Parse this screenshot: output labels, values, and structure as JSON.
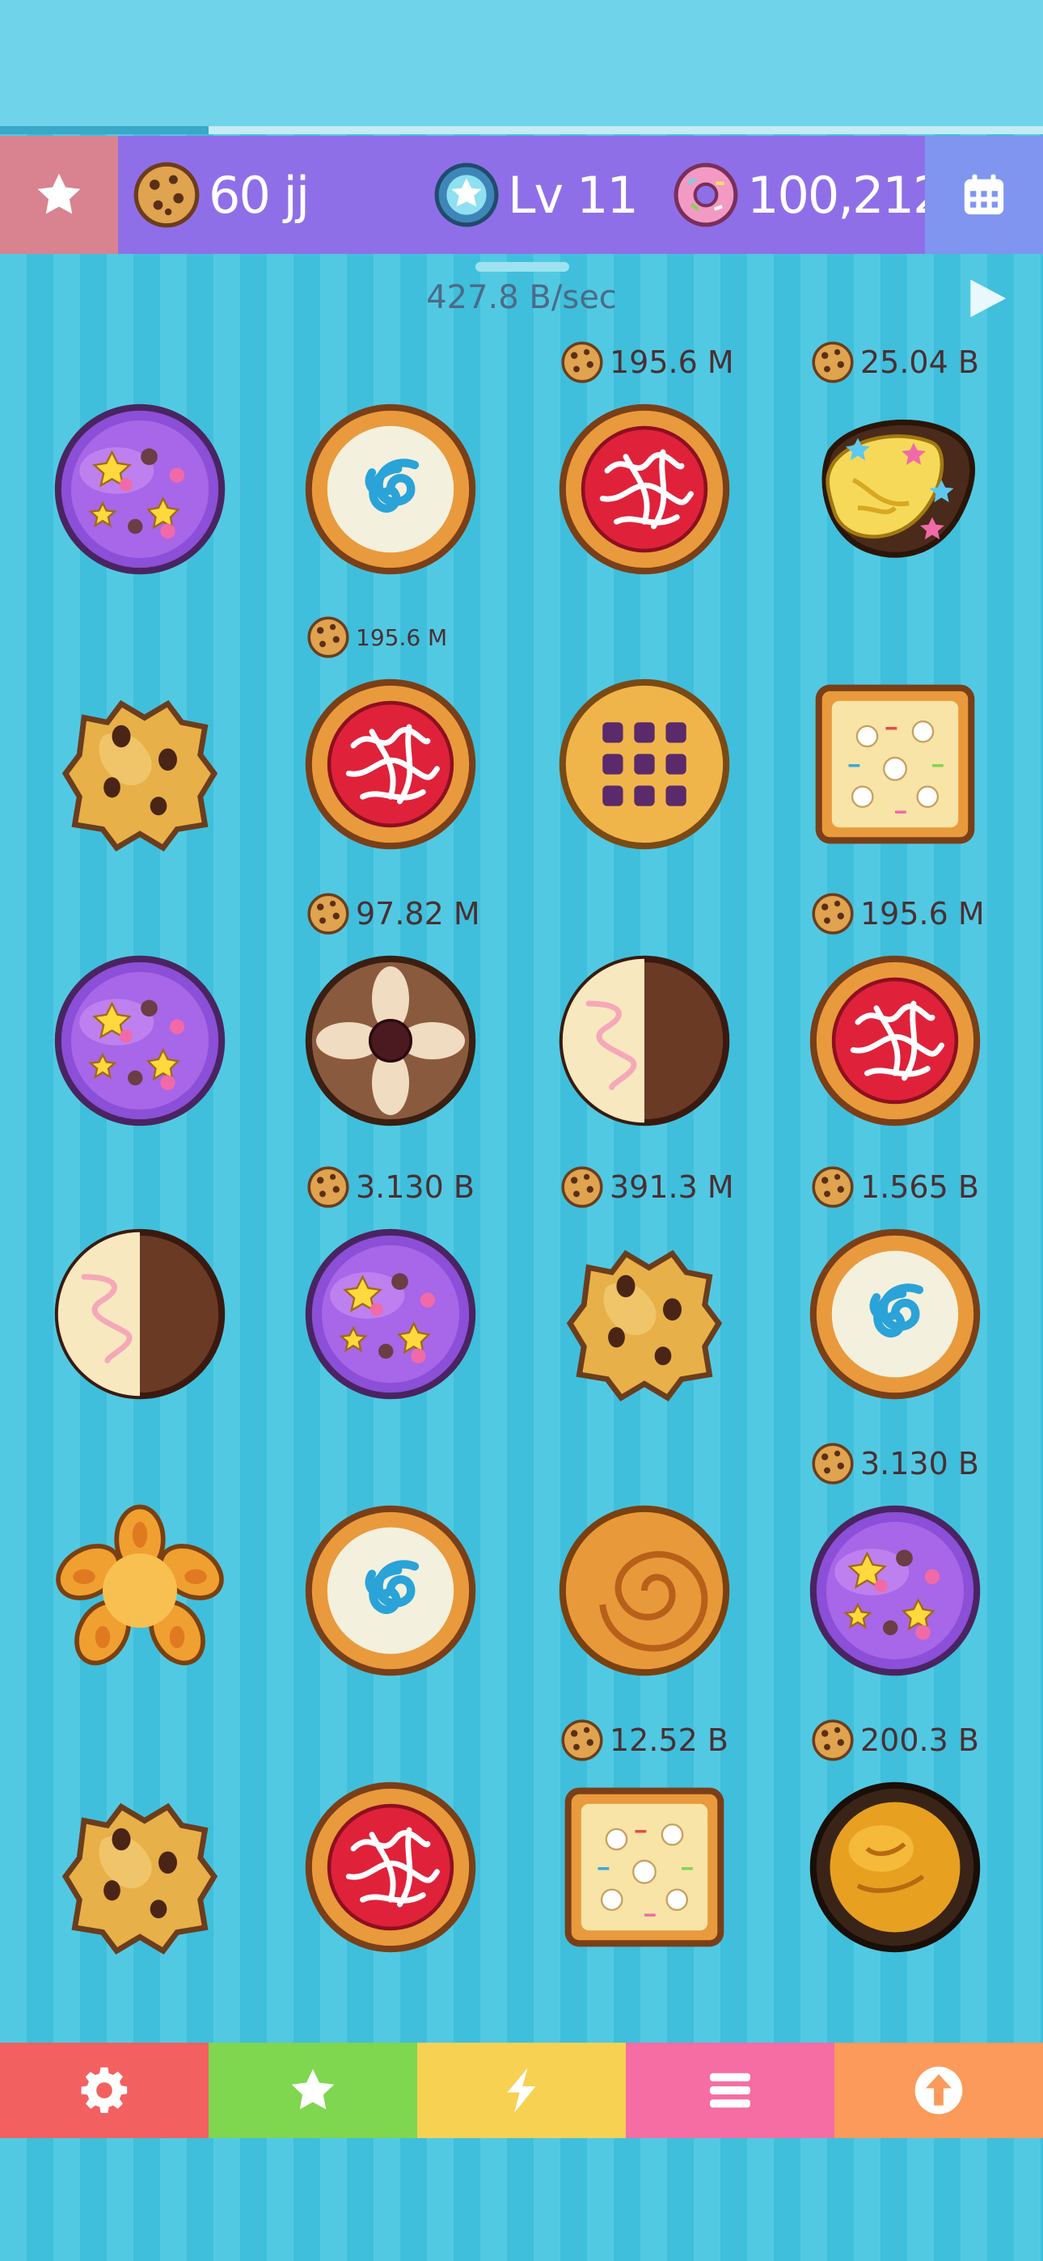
{
  "hud": {
    "cookies": "60 jj",
    "level": "Lv 11",
    "donuts": "100,212",
    "progress_fraction": 0.2
  },
  "rate": "427.8 B/sec",
  "icons": {
    "hud_left": "star-icon",
    "hud_right": "calendar-icon",
    "play": "play-icon",
    "tabs": [
      "gear-icon",
      "star-icon",
      "lightning-icon",
      "menu-icon",
      "upgrade-arrow-icon"
    ]
  },
  "colors": {
    "hud_bar": "#8f6fe8",
    "tab_settings": "#f36060",
    "tab_favorites": "#7fd64f",
    "tab_boost": "#f7d152",
    "tab_menu": "#f66da3",
    "tab_upgrade": "#fb9a5a"
  },
  "cookies": [
    {
      "row": 0,
      "col": 0,
      "type": "galaxy",
      "price": ""
    },
    {
      "row": 0,
      "col": 1,
      "type": "swirl-blue",
      "price": ""
    },
    {
      "row": 0,
      "col": 2,
      "type": "red-pizza",
      "price": "195.6 M"
    },
    {
      "row": 0,
      "col": 3,
      "type": "cream-star",
      "price": "25.04 B"
    },
    {
      "row": 1,
      "col": 0,
      "type": "chunky-chip",
      "price": ""
    },
    {
      "row": 1,
      "col": 1,
      "type": "red-pizza",
      "price": "195.6 M"
    },
    {
      "row": 1,
      "col": 2,
      "type": "waffle-berry",
      "price": ""
    },
    {
      "row": 1,
      "col": 3,
      "type": "square-sprinkle",
      "price": ""
    },
    {
      "row": 2,
      "col": 0,
      "type": "galaxy",
      "price": ""
    },
    {
      "row": 2,
      "col": 1,
      "type": "choc-flower",
      "price": "97.82 M"
    },
    {
      "row": 2,
      "col": 2,
      "type": "half-dipped",
      "price": ""
    },
    {
      "row": 2,
      "col": 3,
      "type": "red-pizza",
      "price": "195.6 M"
    },
    {
      "row": 3,
      "col": 0,
      "type": "half-dipped",
      "price": ""
    },
    {
      "row": 3,
      "col": 1,
      "type": "galaxy",
      "price": "3.130 B"
    },
    {
      "row": 3,
      "col": 2,
      "type": "chunky-chip",
      "price": "391.3 M"
    },
    {
      "row": 3,
      "col": 3,
      "type": "swirl-blue",
      "price": "1.565 B"
    },
    {
      "row": 4,
      "col": 0,
      "type": "orange-flower",
      "price": ""
    },
    {
      "row": 4,
      "col": 1,
      "type": "swirl-blue",
      "price": ""
    },
    {
      "row": 4,
      "col": 2,
      "type": "butter-swirl",
      "price": ""
    },
    {
      "row": 4,
      "col": 3,
      "type": "galaxy",
      "price": "3.130 B"
    },
    {
      "row": 5,
      "col": 0,
      "type": "chunky-chip",
      "price": ""
    },
    {
      "row": 5,
      "col": 1,
      "type": "red-pizza",
      "price": ""
    },
    {
      "row": 5,
      "col": 2,
      "type": "square-sprinkle",
      "price": "12.52 B"
    },
    {
      "row": 5,
      "col": 3,
      "type": "caramel-dark",
      "price": "200.3 B"
    }
  ]
}
